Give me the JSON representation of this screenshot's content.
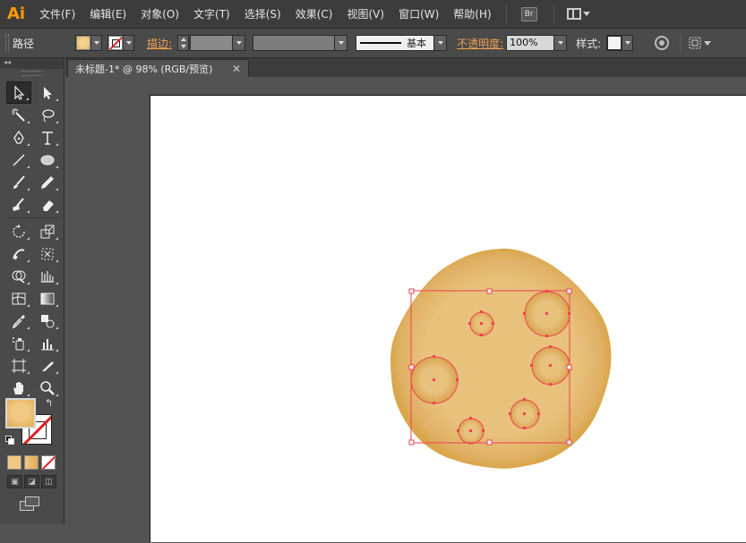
{
  "app": {
    "logo": "Ai"
  },
  "menubar": {
    "items": [
      "文件(F)",
      "编辑(E)",
      "对象(O)",
      "文字(T)",
      "选择(S)",
      "效果(C)",
      "视图(V)",
      "窗口(W)",
      "帮助(H)"
    ],
    "bridge_label": "Br"
  },
  "controlbar": {
    "selection_type": "路径",
    "fill_color": "#f0c883",
    "stroke_label": "描边:",
    "stroke_profile_label": "基本",
    "opacity_label": "不透明度:",
    "opacity_value": "100%",
    "style_label": "样式:"
  },
  "panel": {
    "collapse_label": "◂◂"
  },
  "document": {
    "tab_title": "未标题-1* @ 98% (RGB/预览)",
    "close_glyph": "✕"
  },
  "colors": {
    "cookie_base": "#e8c17c",
    "cookie_edge": "#d9a64a",
    "selection": "#f04050",
    "accent_orange": "#ff9a00"
  },
  "icons": {
    "selection_tool": "selection-arrow-icon",
    "direct_selection_tool": "direct-selection-icon",
    "magic_wand_tool": "magic-wand-icon",
    "lasso_tool": "lasso-icon",
    "pen_tool": "pen-icon",
    "type_tool": "type-icon",
    "line_tool": "line-segment-icon",
    "ellipse_tool": "ellipse-icon",
    "paintbrush_tool": "paintbrush-icon",
    "pencil_tool": "pencil-icon",
    "blob_brush_tool": "blob-brush-icon",
    "eraser_tool": "eraser-icon",
    "rotate_tool": "rotate-icon",
    "scale_tool": "scale-icon",
    "warp_tool": "warp-icon",
    "free_transform_tool": "free-transform-icon",
    "shape_builder_tool": "shape-builder-icon",
    "perspective_grid_tool": "perspective-grid-icon",
    "mesh_tool": "mesh-icon",
    "gradient_tool": "gradient-icon",
    "eyedropper_tool": "eyedropper-icon",
    "blend_tool": "blend-icon",
    "symbol_sprayer_tool": "symbol-sprayer-icon",
    "column_graph_tool": "column-graph-icon",
    "artboard_tool": "artboard-icon",
    "slice_tool": "slice-icon",
    "hand_tool": "hand-icon",
    "zoom_tool": "zoom-icon"
  }
}
